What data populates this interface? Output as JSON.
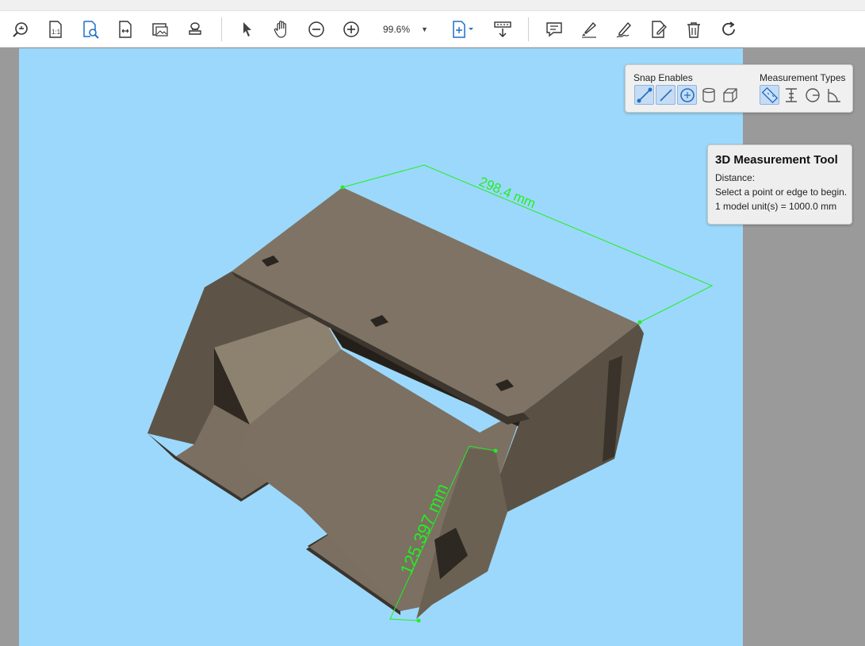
{
  "toolbar": {
    "zoom_value": "99.6%"
  },
  "icons": {
    "find": "zoom-search-icon",
    "actual_size": "actual-size-icon",
    "find_text": "find-document-icon",
    "fit_width": "fit-width-icon",
    "export_image": "export-image-icon",
    "read_mode": "stamp-icon",
    "select": "pointer-arrow-icon",
    "hand": "hand-icon",
    "zoom_out": "zoom-out-icon",
    "zoom_in": "zoom-in-icon",
    "fit_page": "fit-page-icon",
    "scroll": "scroll-mode-icon",
    "comment": "comment-icon",
    "highlight": "highlighter-icon",
    "sign": "sign-pen-icon",
    "fill": "fill-sign-icon",
    "delete": "trash-icon",
    "rotate": "rotate-icon"
  },
  "measure_panel": {
    "snap_label": "Snap Enables",
    "types_label": "Measurement Types"
  },
  "info_tip": {
    "title": "3D Measurement Tool",
    "line1": "Distance:",
    "line2": "Select a point or edge to begin.",
    "line3": "1 model unit(s) = 1000.0 mm"
  },
  "dimensions": {
    "top": "298.4 mm",
    "side": "125.397 mm"
  },
  "colors": {
    "viewport_bg": "#9cd8fb",
    "measure_line": "#22ee22",
    "part_top": "#7d7263",
    "part_side": "#5e5548"
  }
}
